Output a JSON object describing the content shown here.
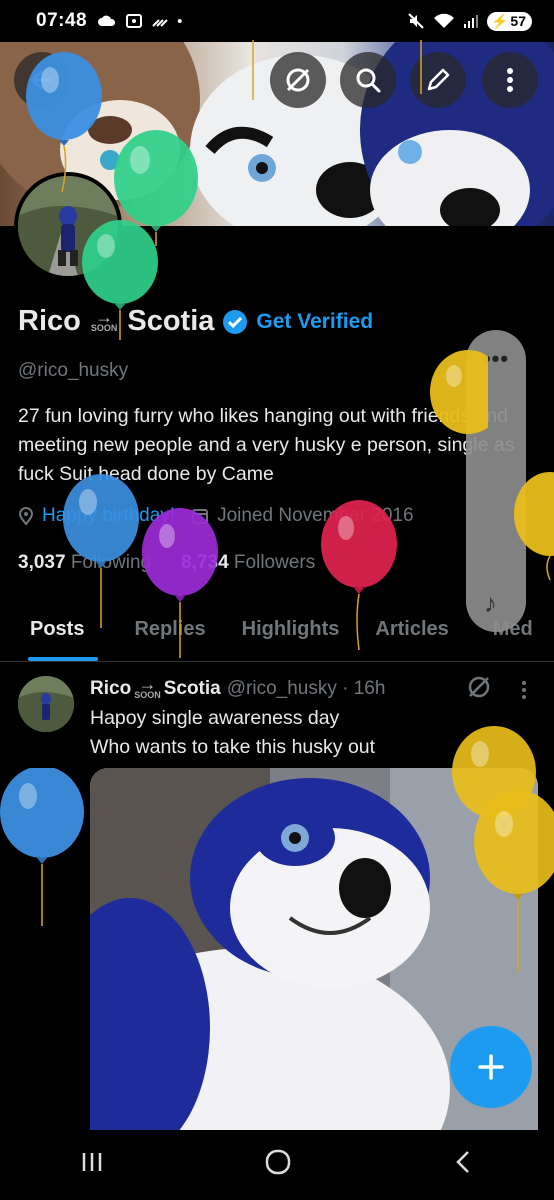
{
  "status": {
    "time": "07:48",
    "battery": "57"
  },
  "profile": {
    "name_first": "Rico",
    "name_soon": "SOON",
    "name_last": "Scotia",
    "get_verified": "Get Verified",
    "handle": "@rico_husky",
    "bio": "27  fun loving furry who likes hanging out with friends and meeting new people and a very husky e person, single as fuck Suit head done by Came",
    "birthday": "Happy birthday!",
    "joined": "Joined November 2016",
    "following_count": "3,037",
    "following_label": "Following",
    "followers_count": "8,734",
    "followers_label": "Followers"
  },
  "tabs": [
    "Posts",
    "Replies",
    "Highlights",
    "Articles",
    "Med"
  ],
  "post": {
    "name_first": "Rico",
    "name_soon": "SOON",
    "name_last": "Scotia",
    "handle_time": "@rico_husky · 16h",
    "line1": "Hapoy single awareness day",
    "line2": "Who wants to take this husky out"
  },
  "icons": {
    "back": "arrow-left-icon",
    "grok": "slash-circle-icon",
    "search": "search-icon",
    "edit": "pencil-icon",
    "more": "more-vertical-icon",
    "verified": "verified-badge-icon",
    "location": "location-pin-icon",
    "calendar": "calendar-icon",
    "compose": "plus-icon",
    "music": "music-note-icon"
  },
  "colors": {
    "accent": "#1d9bf0",
    "muted": "#71767b",
    "text": "#e7e9ea"
  }
}
